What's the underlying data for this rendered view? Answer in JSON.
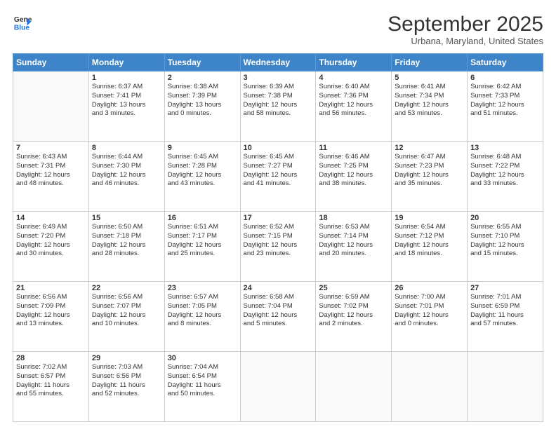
{
  "header": {
    "logo_line1": "General",
    "logo_line2": "Blue",
    "title": "September 2025",
    "subtitle": "Urbana, Maryland, United States"
  },
  "days_of_week": [
    "Sunday",
    "Monday",
    "Tuesday",
    "Wednesday",
    "Thursday",
    "Friday",
    "Saturday"
  ],
  "weeks": [
    [
      {
        "day": "",
        "info": ""
      },
      {
        "day": "1",
        "info": "Sunrise: 6:37 AM\nSunset: 7:41 PM\nDaylight: 13 hours\nand 3 minutes."
      },
      {
        "day": "2",
        "info": "Sunrise: 6:38 AM\nSunset: 7:39 PM\nDaylight: 13 hours\nand 0 minutes."
      },
      {
        "day": "3",
        "info": "Sunrise: 6:39 AM\nSunset: 7:38 PM\nDaylight: 12 hours\nand 58 minutes."
      },
      {
        "day": "4",
        "info": "Sunrise: 6:40 AM\nSunset: 7:36 PM\nDaylight: 12 hours\nand 56 minutes."
      },
      {
        "day": "5",
        "info": "Sunrise: 6:41 AM\nSunset: 7:34 PM\nDaylight: 12 hours\nand 53 minutes."
      },
      {
        "day": "6",
        "info": "Sunrise: 6:42 AM\nSunset: 7:33 PM\nDaylight: 12 hours\nand 51 minutes."
      }
    ],
    [
      {
        "day": "7",
        "info": "Sunrise: 6:43 AM\nSunset: 7:31 PM\nDaylight: 12 hours\nand 48 minutes."
      },
      {
        "day": "8",
        "info": "Sunrise: 6:44 AM\nSunset: 7:30 PM\nDaylight: 12 hours\nand 46 minutes."
      },
      {
        "day": "9",
        "info": "Sunrise: 6:45 AM\nSunset: 7:28 PM\nDaylight: 12 hours\nand 43 minutes."
      },
      {
        "day": "10",
        "info": "Sunrise: 6:45 AM\nSunset: 7:27 PM\nDaylight: 12 hours\nand 41 minutes."
      },
      {
        "day": "11",
        "info": "Sunrise: 6:46 AM\nSunset: 7:25 PM\nDaylight: 12 hours\nand 38 minutes."
      },
      {
        "day": "12",
        "info": "Sunrise: 6:47 AM\nSunset: 7:23 PM\nDaylight: 12 hours\nand 35 minutes."
      },
      {
        "day": "13",
        "info": "Sunrise: 6:48 AM\nSunset: 7:22 PM\nDaylight: 12 hours\nand 33 minutes."
      }
    ],
    [
      {
        "day": "14",
        "info": "Sunrise: 6:49 AM\nSunset: 7:20 PM\nDaylight: 12 hours\nand 30 minutes."
      },
      {
        "day": "15",
        "info": "Sunrise: 6:50 AM\nSunset: 7:18 PM\nDaylight: 12 hours\nand 28 minutes."
      },
      {
        "day": "16",
        "info": "Sunrise: 6:51 AM\nSunset: 7:17 PM\nDaylight: 12 hours\nand 25 minutes."
      },
      {
        "day": "17",
        "info": "Sunrise: 6:52 AM\nSunset: 7:15 PM\nDaylight: 12 hours\nand 23 minutes."
      },
      {
        "day": "18",
        "info": "Sunrise: 6:53 AM\nSunset: 7:14 PM\nDaylight: 12 hours\nand 20 minutes."
      },
      {
        "day": "19",
        "info": "Sunrise: 6:54 AM\nSunset: 7:12 PM\nDaylight: 12 hours\nand 18 minutes."
      },
      {
        "day": "20",
        "info": "Sunrise: 6:55 AM\nSunset: 7:10 PM\nDaylight: 12 hours\nand 15 minutes."
      }
    ],
    [
      {
        "day": "21",
        "info": "Sunrise: 6:56 AM\nSunset: 7:09 PM\nDaylight: 12 hours\nand 13 minutes."
      },
      {
        "day": "22",
        "info": "Sunrise: 6:56 AM\nSunset: 7:07 PM\nDaylight: 12 hours\nand 10 minutes."
      },
      {
        "day": "23",
        "info": "Sunrise: 6:57 AM\nSunset: 7:05 PM\nDaylight: 12 hours\nand 8 minutes."
      },
      {
        "day": "24",
        "info": "Sunrise: 6:58 AM\nSunset: 7:04 PM\nDaylight: 12 hours\nand 5 minutes."
      },
      {
        "day": "25",
        "info": "Sunrise: 6:59 AM\nSunset: 7:02 PM\nDaylight: 12 hours\nand 2 minutes."
      },
      {
        "day": "26",
        "info": "Sunrise: 7:00 AM\nSunset: 7:01 PM\nDaylight: 12 hours\nand 0 minutes."
      },
      {
        "day": "27",
        "info": "Sunrise: 7:01 AM\nSunset: 6:59 PM\nDaylight: 11 hours\nand 57 minutes."
      }
    ],
    [
      {
        "day": "28",
        "info": "Sunrise: 7:02 AM\nSunset: 6:57 PM\nDaylight: 11 hours\nand 55 minutes."
      },
      {
        "day": "29",
        "info": "Sunrise: 7:03 AM\nSunset: 6:56 PM\nDaylight: 11 hours\nand 52 minutes."
      },
      {
        "day": "30",
        "info": "Sunrise: 7:04 AM\nSunset: 6:54 PM\nDaylight: 11 hours\nand 50 minutes."
      },
      {
        "day": "",
        "info": ""
      },
      {
        "day": "",
        "info": ""
      },
      {
        "day": "",
        "info": ""
      },
      {
        "day": "",
        "info": ""
      }
    ]
  ]
}
